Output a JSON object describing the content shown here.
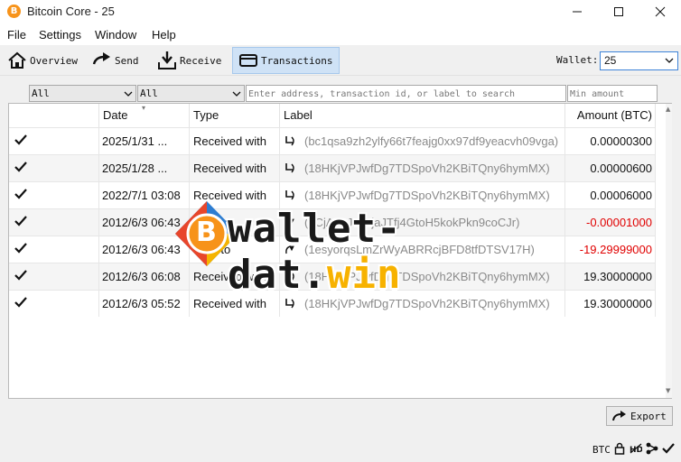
{
  "window": {
    "title": "Bitcoin Core - 25",
    "app_icon_glyph": "B"
  },
  "menu": [
    "File",
    "Settings",
    "Window",
    "Help"
  ],
  "toolbar": {
    "overview": "Overview",
    "send": "Send",
    "receive": "Receive",
    "transactions": "Transactions",
    "active_tab": "Transactions"
  },
  "wallet": {
    "label": "Wallet:",
    "value": "25"
  },
  "filters": {
    "date": "All",
    "type": "All",
    "search_placeholder": "Enter address, transaction id, or label to search",
    "min_amount_placeholder": "Min amount"
  },
  "table": {
    "headers": {
      "date": "Date",
      "type": "Type",
      "label": "Label",
      "amount": "Amount (BTC)"
    },
    "rows": [
      {
        "date": "2025/1/31 ...",
        "type": "Received with",
        "label": "(bc1qsa9zh2ylfy66t7feajg0xx97df9yeacvh09vga)",
        "amount": "0.00000300",
        "negative": false
      },
      {
        "date": "2025/1/28 ...",
        "type": "Received with",
        "label": "(18HKjVPJwfDg7TDSpoVh2KBiTQny6hymMX)",
        "amount": "0.00000600",
        "negative": false
      },
      {
        "date": "2022/7/1 03:08",
        "type": "Received with",
        "label": "(18HKjVPJwfDg7TDSpoVh2KBiTQny6hymMX)",
        "amount": "0.00006000",
        "negative": false
      },
      {
        "date": "2012/6/3 06:43",
        "type": "Sent to",
        "label": "(1CjA2LJUerjaJTfj4GtoH5kokPkn9coCJr)",
        "amount": "-0.00001000",
        "negative": true
      },
      {
        "date": "2012/6/3 06:43",
        "type": "Sent to",
        "label": "(1esyorqsLmZrWyABRRcjBFD8tfDTSV17H)",
        "amount": "-19.29999000",
        "negative": true
      },
      {
        "date": "2012/6/3 06:08",
        "type": "Received with",
        "label": "(18HKjVPJwfDg7TDSpoVh2KBiTQny6hymMX)",
        "amount": "19.30000000",
        "negative": false
      },
      {
        "date": "2012/6/3 05:52",
        "type": "Received with",
        "label": "(18HKjVPJwfDg7TDSpoVh2KBiTQny6hymMX)",
        "amount": "19.30000000",
        "negative": false
      }
    ]
  },
  "watermark": {
    "name": "wallet-dat",
    "dot": ".",
    "tld": "win",
    "coin_glyph": "B"
  },
  "export_label": "Export",
  "status": {
    "unit": "BTC"
  },
  "colors": {
    "accent": "#3d83d8",
    "negative": "#e00000",
    "bitcoin_orange": "#f7931a",
    "active_tab_bg": "#cfe2f6"
  }
}
